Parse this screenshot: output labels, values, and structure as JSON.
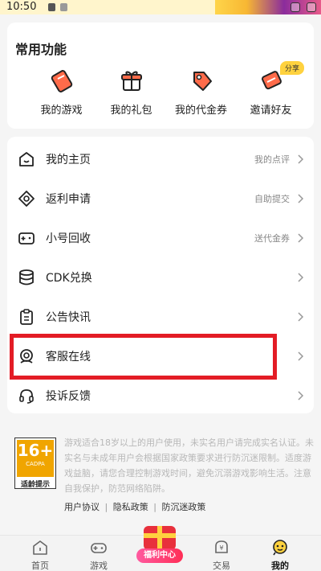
{
  "status_bar": {
    "time": "10:50"
  },
  "functions": {
    "title": "常用功能",
    "badge": "分享",
    "items": [
      {
        "label": "我的游戏",
        "icon": "game-card-icon"
      },
      {
        "label": "我的礼包",
        "icon": "gift-box-icon"
      },
      {
        "label": "我的代金券",
        "icon": "voucher-tag-icon"
      },
      {
        "label": "邀请好友",
        "icon": "invite-card-icon"
      }
    ]
  },
  "menu": {
    "items": [
      {
        "label": "我的主页",
        "hint": "我的点评",
        "icon": "home-icon"
      },
      {
        "label": "返利申请",
        "hint": "自助提交",
        "icon": "rebate-icon"
      },
      {
        "label": "小号回收",
        "hint": "送代金券",
        "icon": "gamepad-icon"
      },
      {
        "label": "CDK兑换",
        "hint": "",
        "icon": "database-icon"
      },
      {
        "label": "公告快讯",
        "hint": "",
        "icon": "clipboard-icon"
      },
      {
        "label": "客服在线",
        "hint": "",
        "icon": "customer-service-icon"
      },
      {
        "label": "投诉反馈",
        "hint": "",
        "icon": "headset-icon"
      }
    ]
  },
  "age_rating": {
    "number": "16+",
    "org": "CADPA",
    "caption": "适龄提示"
  },
  "notice": "游戏适合18岁以上的用户使用，未实名用户请完成实名认证。未实名与未成年用户会根据国家政策要求进行防沉迷限制。适度游戏益脑，请您合理控制游戏时间，避免沉溺游戏影响生活。注意自我保护，防范网络陷阱。",
  "policy": {
    "user_agreement": "用户协议",
    "privacy": "隐私政策",
    "anti_addiction": "防沉迷政策",
    "separator": "|"
  },
  "tabs": [
    {
      "label": "首页",
      "icon": "home-tab-icon"
    },
    {
      "label": "游戏",
      "icon": "gamepad-tab-icon"
    },
    {
      "label": "福利中心",
      "icon": "welfare-gift-icon"
    },
    {
      "label": "交易",
      "icon": "trade-icon"
    },
    {
      "label": "我的",
      "icon": "profile-icon",
      "active": true
    }
  ],
  "colors": {
    "accent": "#ff5a3c",
    "highlight": "#e31c25",
    "badge": "#ffd23f"
  }
}
